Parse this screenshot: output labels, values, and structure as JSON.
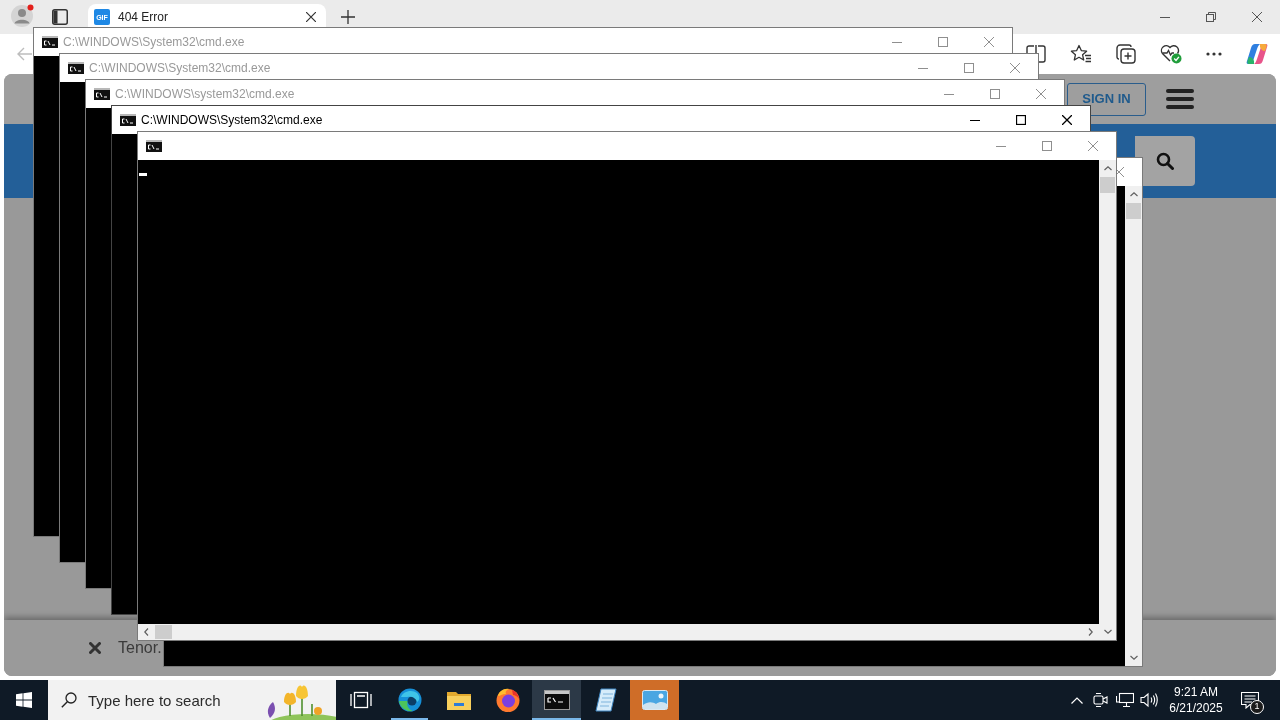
{
  "browser": {
    "tab": {
      "favicon": "GIF",
      "title": "404 Error"
    },
    "page": {
      "sign_in": "SIGN IN",
      "footer_text": "Tenor."
    }
  },
  "console_windows": [
    {
      "title": "C:\\WINDOWS\\System32\\cmd.exe",
      "active": false,
      "controls": [
        {
          "kind": "app-icon"
        },
        {
          "kind": "minimize"
        },
        {
          "kind": "maximize"
        },
        {
          "kind": "close"
        }
      ]
    },
    {
      "title": "C:\\WINDOWS\\System32\\cmd.exe",
      "active": false,
      "controls": [
        {
          "kind": "app-icon"
        },
        {
          "kind": "minimize"
        },
        {
          "kind": "maximize"
        },
        {
          "kind": "close"
        }
      ]
    },
    {
      "title": "C:\\WINDOWS\\system32\\cmd.exe",
      "active": false,
      "controls": [
        {
          "kind": "app-icon"
        },
        {
          "kind": "minimize"
        },
        {
          "kind": "maximize"
        },
        {
          "kind": "close"
        }
      ]
    },
    {
      "title": "C:\\WINDOWS\\System32\\cmd.exe",
      "active": true,
      "controls": [
        {
          "kind": "app-icon"
        },
        {
          "kind": "minimize"
        },
        {
          "kind": "maximize"
        },
        {
          "kind": "close"
        }
      ]
    },
    {
      "active": false,
      "cursor": true,
      "scrollbar_vertical": true,
      "scrollbar_horizontal": true,
      "controls": [
        {
          "kind": "app-icon"
        },
        {
          "kind": "minimize"
        },
        {
          "kind": "maximize"
        },
        {
          "kind": "close"
        }
      ]
    },
    {
      "active": false,
      "scrollbar_vertical": true,
      "controls": [
        {
          "kind": "close"
        }
      ]
    }
  ],
  "taskbar": {
    "search": {
      "placeholder": "Type here to search"
    },
    "apps": [
      {
        "kind": "task-view",
        "selected": false
      },
      {
        "kind": "swirl-browser",
        "running": true,
        "selected": false
      },
      {
        "kind": "folder",
        "selected": false
      },
      {
        "kind": "fox-browser",
        "selected": false
      },
      {
        "kind": "terminal",
        "running": true,
        "selected": true
      },
      {
        "kind": "notepad",
        "selected": false
      },
      {
        "kind": "picture",
        "selected": false,
        "attention": true
      }
    ],
    "tray": {
      "time": "9:21 AM",
      "date": "6/21/2025",
      "notifications": "1"
    }
  }
}
